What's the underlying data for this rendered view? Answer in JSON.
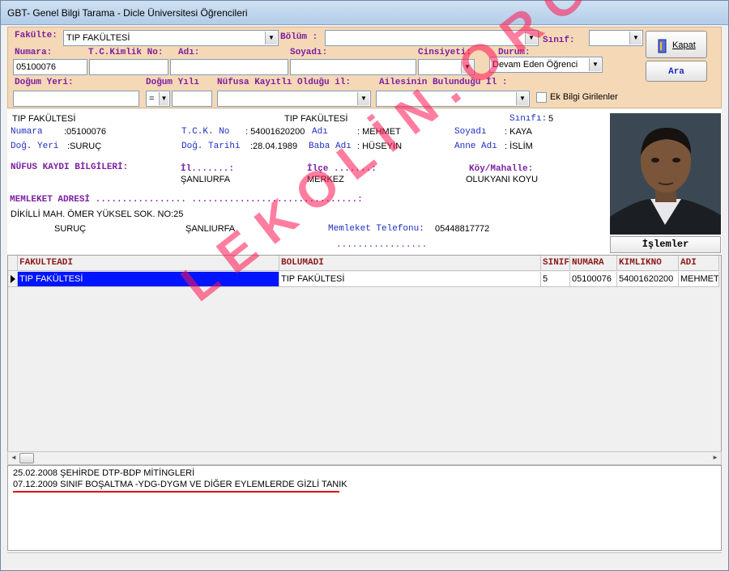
{
  "window": {
    "title": "GBT- Genel Bilgi Tarama - Dicle Üniversitesi Öğrencileri"
  },
  "filters": {
    "fakulte_label": "Fakülte:",
    "fakulte_value": "TIP FAKÜLTESİ",
    "bolum_label": "Bölüm :",
    "bolum_value": "",
    "sinif_label": "Sınıf:",
    "sinif_value": "",
    "numara_label": "Numara:",
    "numara_value": "05100076",
    "tckimlik_label": "T.C.Kimlik No:",
    "tckimlik_value": "",
    "adi_label": "Adı:",
    "adi_value": "",
    "soyadi_label": "Soyadı:",
    "soyadi_value": "",
    "cinsiyeti_label": "Cinsiyeti:",
    "cinsiyeti_value": "",
    "durum_label": "Durum:",
    "durum_value": "Devam Eden Öğrenci",
    "dogum_yeri_label": "Doğum Yeri:",
    "dogum_yeri_value": "",
    "dogum_yili_label": "Doğum Yılı",
    "dogum_yili_op": "=",
    "dogum_yili_value": "",
    "nufus_il_label": "Nüfusa Kayıtlı Olduğu il:",
    "nufus_il_value": "",
    "aile_il_label": "Ailesinin Bulunduğu İl :",
    "aile_il_value": "",
    "ek_bilgi_label": "Ek Bilgi Girilenler",
    "ek_bilgi_checked": false
  },
  "buttons": {
    "kapat": "Kapat",
    "ara": "Ara",
    "islemler": "İşlemler"
  },
  "student": {
    "fakulte": "TIP FAKÜLTESİ",
    "bolum": "TIP FAKÜLTESİ",
    "sinif_label": "Sınıfı:",
    "sinif": "5",
    "numara_label": "Numara",
    "numara": ":05100076",
    "tck_label": "T.C.K. No",
    "tck": ": 54001620200",
    "adi_label": "Adı",
    "adi": ": MEHMET",
    "soyadi_label": "Soyadı",
    "soyadi": ": KAYA",
    "dog_yeri_label": "Doğ. Yeri",
    "dog_yeri": ":SURUÇ",
    "dog_tarihi_label": "Doğ. Tarihi",
    "dog_tarihi": ":28.04.1989",
    "baba_label": "Baba Adı",
    "baba": ": HÜSEYİN",
    "anne_label": "Anne Adı",
    "anne": ": İSLİM",
    "nufus_heading": "NÜFUS KAYDI BİLGİLERİ:",
    "il_label": "İl.......:",
    "il": "ŞANLIURFA",
    "ilce_label": "İlçe .......:",
    "ilce": "MERKEZ",
    "koy_label": "Köy/Mahalle:",
    "koy": "OLUKYANI KOYU",
    "memleket_heading": "MEMLEKET ADRESİ  ................. ...............................:",
    "adres": "DİKİLLİ MAH. ÖMER YÜKSEL SOK. NO:25",
    "adres_ilce": "SURUÇ",
    "adres_il": "ŞANLIURFA",
    "tel_label": "Memleket Telefonu:",
    "tel": "05448817772",
    "tel_dots": "................."
  },
  "grid": {
    "columns": [
      "FAKULTEADI",
      "BOLUMADI",
      "SINIF",
      "NUMARA",
      "KIMLIKNO",
      "ADI"
    ],
    "rows": [
      [
        "TIP FAKÜLTESİ",
        "TIP FAKÜLTESİ",
        "5",
        "05100076",
        "54001620200",
        "MEHMET"
      ]
    ]
  },
  "notes": [
    "25.02.2008 ŞEHİRDE DTP-BDP MİTİNGLERİ",
    "07.12.2009 SINIF BOŞALTMA -YDG-DYGM VE DİĞER EYLEMLERDE  GİZLİ TANIK"
  ],
  "watermark": "LEKOLİN.ORG",
  "colors": {
    "filter_bg": "#f5d8b6",
    "label_purple": "#7b1fa2",
    "label_blue": "#1f2fbf",
    "header_red": "#8b1a1a",
    "selection": "#0014ff",
    "watermark": "#ff1450"
  }
}
